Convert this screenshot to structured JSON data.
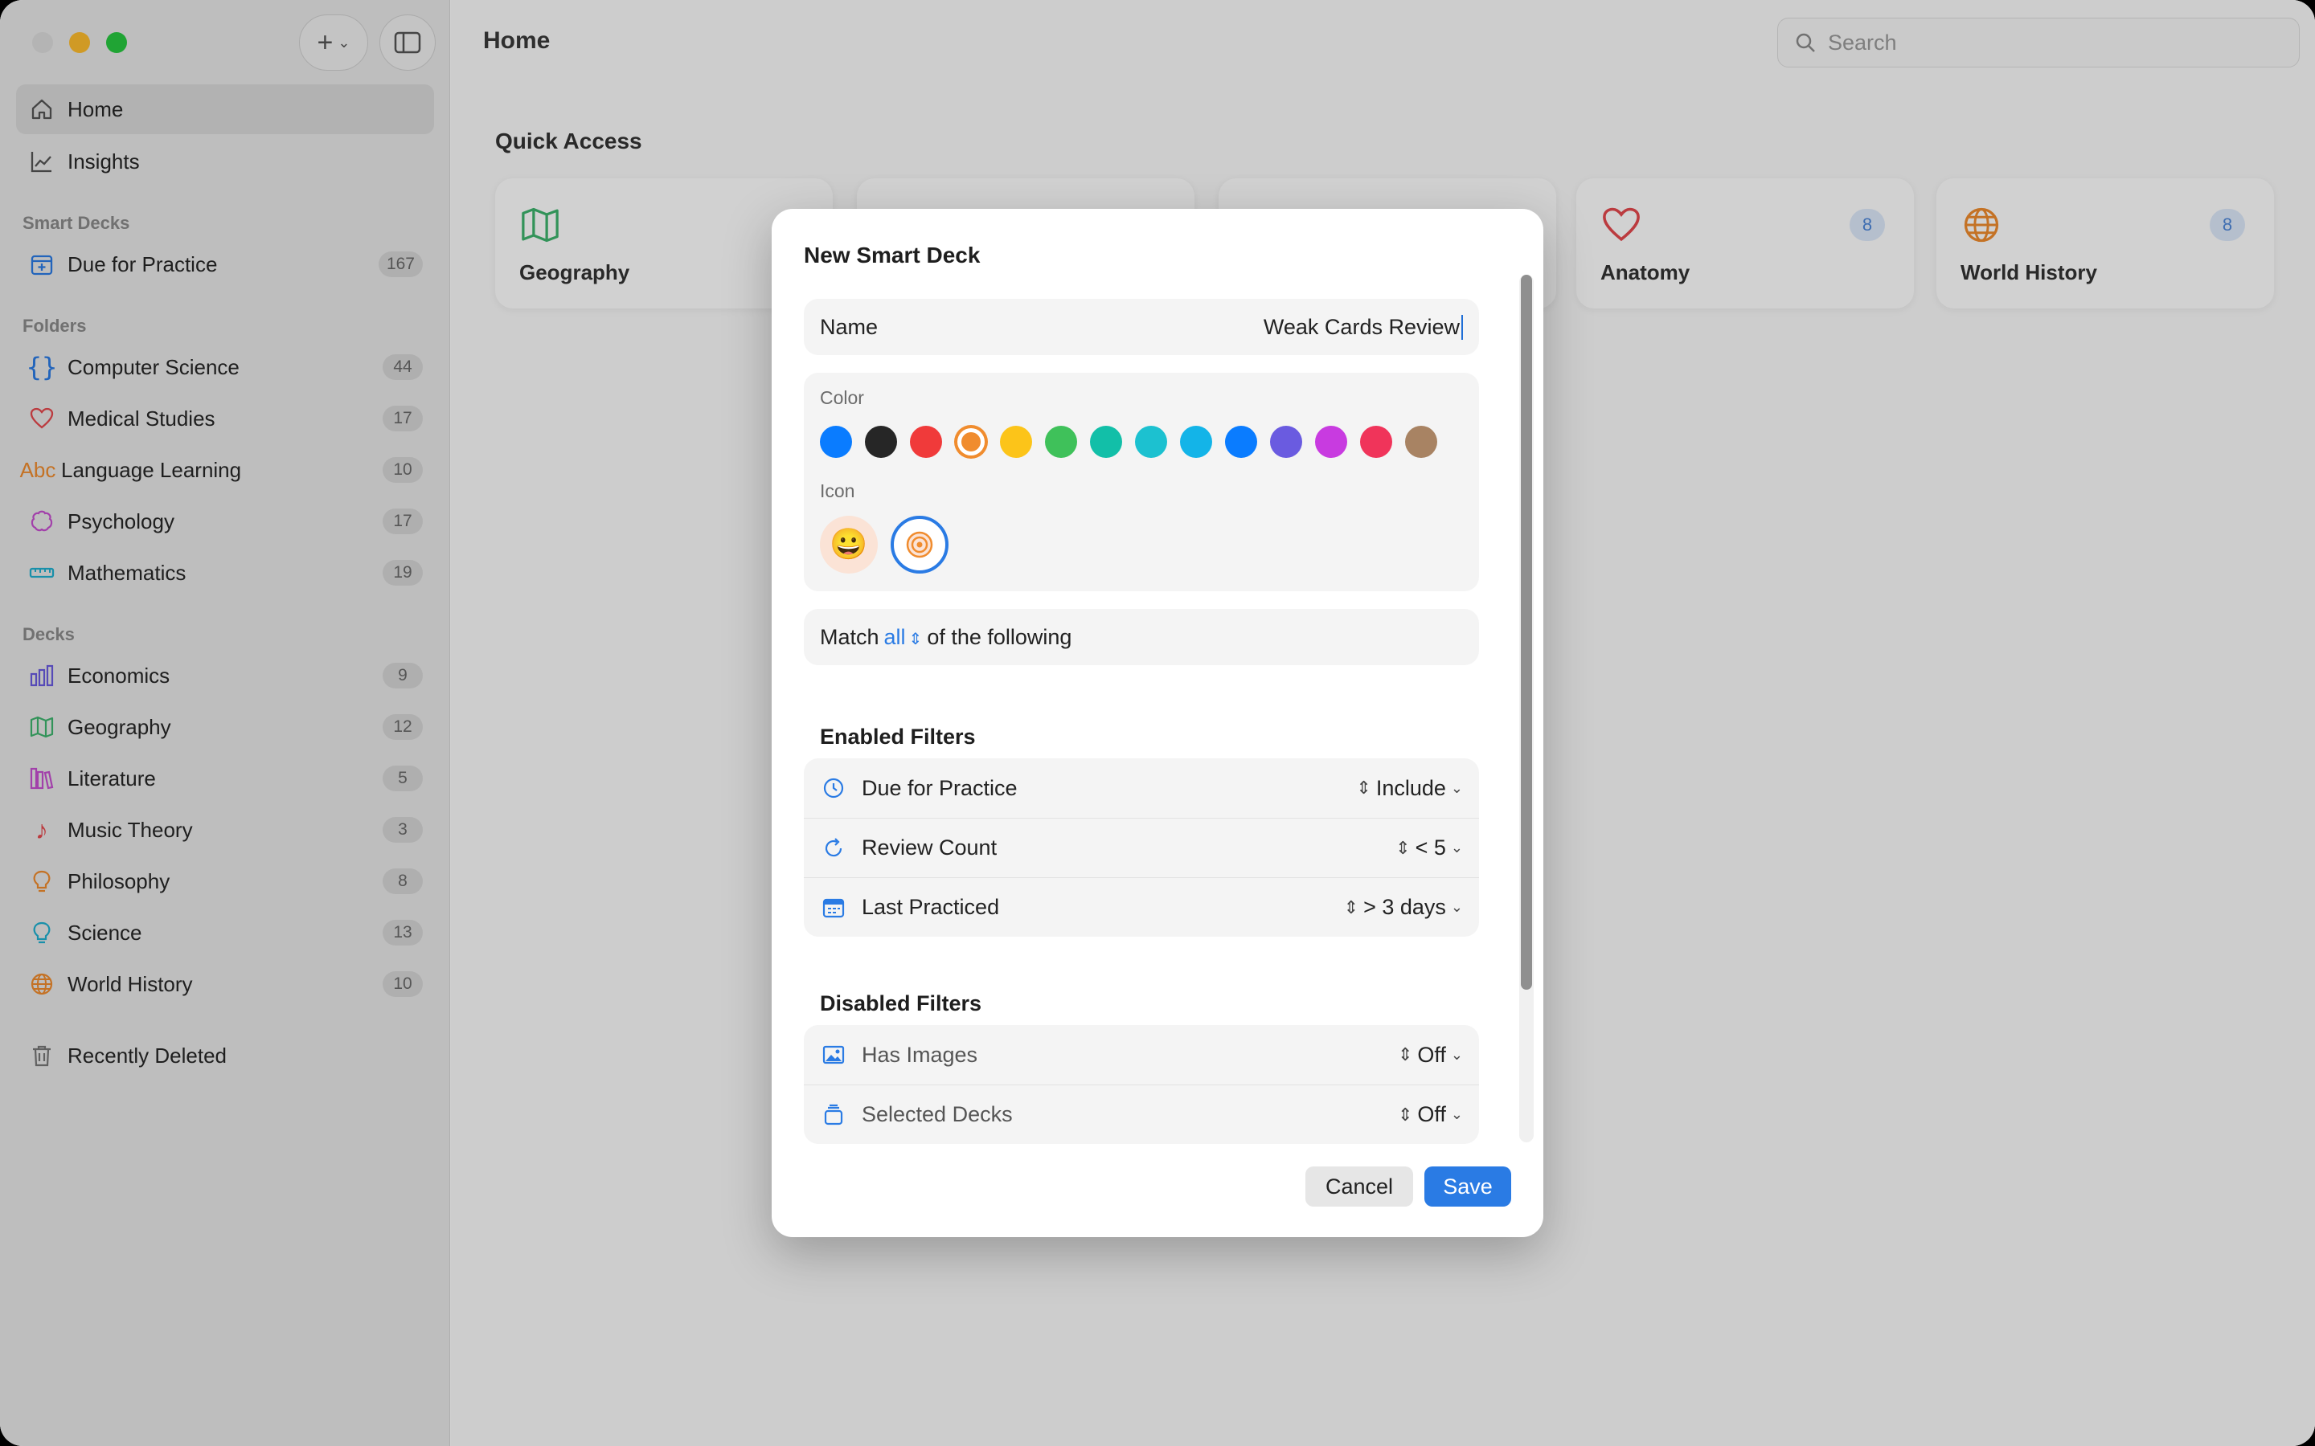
{
  "window": {
    "title": "Home"
  },
  "toolbar": {
    "search_placeholder": "Search"
  },
  "sidebar": {
    "top_items": [
      {
        "label": "Home",
        "icon": "house-icon",
        "active": true
      },
      {
        "label": "Insights",
        "icon": "chart-line-icon"
      }
    ],
    "smart_decks_heading": "Smart Decks",
    "smart_decks": [
      {
        "label": "Due for Practice",
        "count": "167",
        "icon": "calendar-plus-icon",
        "color": "#2a7be4"
      }
    ],
    "folders_heading": "Folders",
    "folders": [
      {
        "label": "Computer Science",
        "count": "44",
        "icon": "braces-icon",
        "color": "#2a7be4"
      },
      {
        "label": "Medical Studies",
        "count": "17",
        "icon": "heart-icon",
        "color": "#e5484d"
      },
      {
        "label": "Language Learning",
        "count": "10",
        "icon": "abc-icon",
        "color": "#f08c2e"
      },
      {
        "label": "Psychology",
        "count": "17",
        "icon": "brain-icon",
        "color": "#c64fd0"
      },
      {
        "label": "Mathematics",
        "count": "19",
        "icon": "ruler-icon",
        "color": "#1fb0d0"
      }
    ],
    "decks_heading": "Decks",
    "decks": [
      {
        "label": "Economics",
        "count": "9",
        "icon": "bar-chart-icon",
        "color": "#6a5be0"
      },
      {
        "label": "Geography",
        "count": "12",
        "icon": "map-icon",
        "color": "#3db46d"
      },
      {
        "label": "Literature",
        "count": "5",
        "icon": "books-icon",
        "color": "#c64fd0"
      },
      {
        "label": "Music Theory",
        "count": "3",
        "icon": "music-note-icon",
        "color": "#e5484d"
      },
      {
        "label": "Philosophy",
        "count": "8",
        "icon": "lightbulb-icon",
        "color": "#f08c2e"
      },
      {
        "label": "Science",
        "count": "13",
        "icon": "bulb-icon",
        "color": "#1fb0d0"
      },
      {
        "label": "World History",
        "count": "10",
        "icon": "globe-icon",
        "color": "#f08c2e"
      }
    ],
    "recently_deleted": "Recently Deleted"
  },
  "main": {
    "quick_access_title": "Quick Access",
    "cards": [
      {
        "name": "Geography",
        "icon": "map-icon",
        "color": "#3db46d",
        "badge": ""
      },
      {
        "name": "Anatomy",
        "icon": "heart-icon",
        "color": "#e5484d",
        "badge": "8"
      },
      {
        "name": "World History",
        "icon": "globe-icon",
        "color": "#f08c2e",
        "badge": "8"
      }
    ]
  },
  "dialog": {
    "title": "New Smart Deck",
    "name_label": "Name",
    "name_value": "Weak Cards Review",
    "color_label": "Color",
    "colors": [
      "#0a7cff",
      "#262626",
      "#f03a3a",
      "#f08c2e",
      "#fcc419",
      "#3fc15a",
      "#12bfa8",
      "#1cc1d0",
      "#13b4e8",
      "#0a7cff",
      "#6a5be0",
      "#c83be0",
      "#f0345a",
      "#a88363"
    ],
    "selected_color": "#f08c2e",
    "icon_label": "Icon",
    "icon_options": [
      "😀",
      "◎"
    ],
    "match_prefix": "Match",
    "match_value": "all",
    "match_suffix": "of the following",
    "enabled_heading": "Enabled Filters",
    "enabled_filters": [
      {
        "label": "Due for Practice",
        "value": "Include",
        "icon": "clock-history-icon"
      },
      {
        "label": "Review Count",
        "value": "< 5",
        "icon": "refresh-icon"
      },
      {
        "label": "Last Practiced",
        "value": "> 3 days",
        "icon": "calendar-icon"
      }
    ],
    "disabled_heading": "Disabled Filters",
    "disabled_filters": [
      {
        "label": "Has Images",
        "value": "Off",
        "icon": "photo-icon"
      },
      {
        "label": "Selected Decks",
        "value": "Off",
        "icon": "stack-icon"
      }
    ],
    "cancel_label": "Cancel",
    "save_label": "Save"
  }
}
